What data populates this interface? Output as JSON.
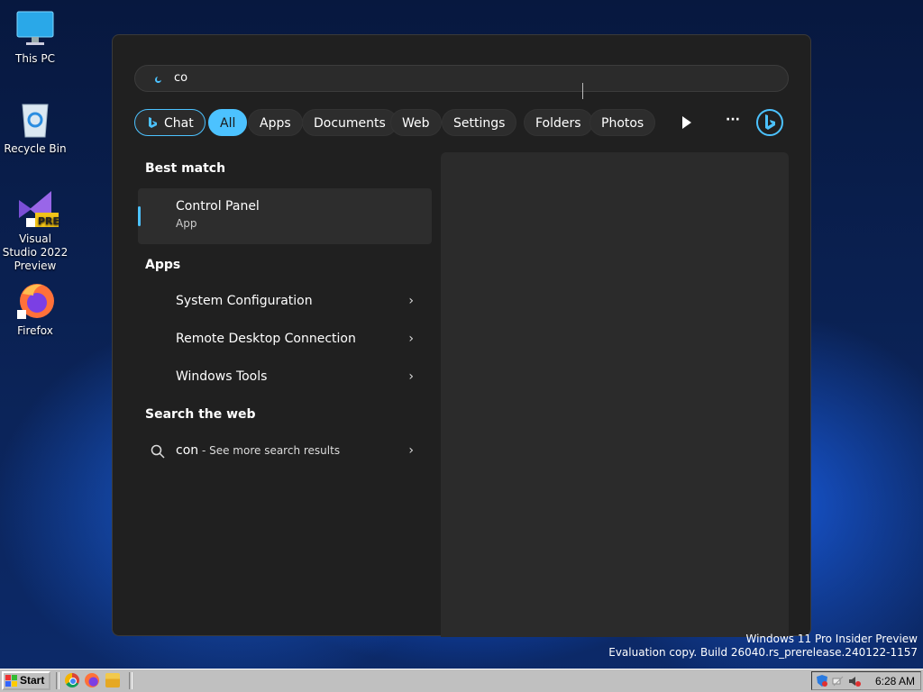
{
  "desktop": {
    "icons": [
      {
        "label": "This PC"
      },
      {
        "label": "Recycle Bin"
      },
      {
        "label": "Visual Studio 2022 Preview"
      },
      {
        "label": "Firefox"
      }
    ]
  },
  "search": {
    "query": "co"
  },
  "filters": {
    "chat": "Chat",
    "all": "All",
    "apps": "Apps",
    "documents": "Documents",
    "web": "Web",
    "settings": "Settings",
    "folders": "Folders",
    "photos": "Photos",
    "more": "···"
  },
  "results": {
    "best_match_heading": "Best match",
    "best_match": {
      "title": "Control Panel",
      "subtitle": "App"
    },
    "apps_heading": "Apps",
    "apps": [
      {
        "label": "System Configuration"
      },
      {
        "label": "Remote Desktop Connection"
      },
      {
        "label": "Windows Tools"
      }
    ],
    "web_heading": "Search the web",
    "web": {
      "query": "con",
      "suffix": " - See more search results"
    }
  },
  "watermark": {
    "line1": "Windows 11 Pro Insider Preview",
    "line2": "Evaluation copy. Build 26040.rs_prerelease.240122-1157"
  },
  "taskbar": {
    "start_label": "Start",
    "clock": "6:28 AM"
  },
  "colors": {
    "accent": "#4cc2ff",
    "panel": "#202020"
  }
}
